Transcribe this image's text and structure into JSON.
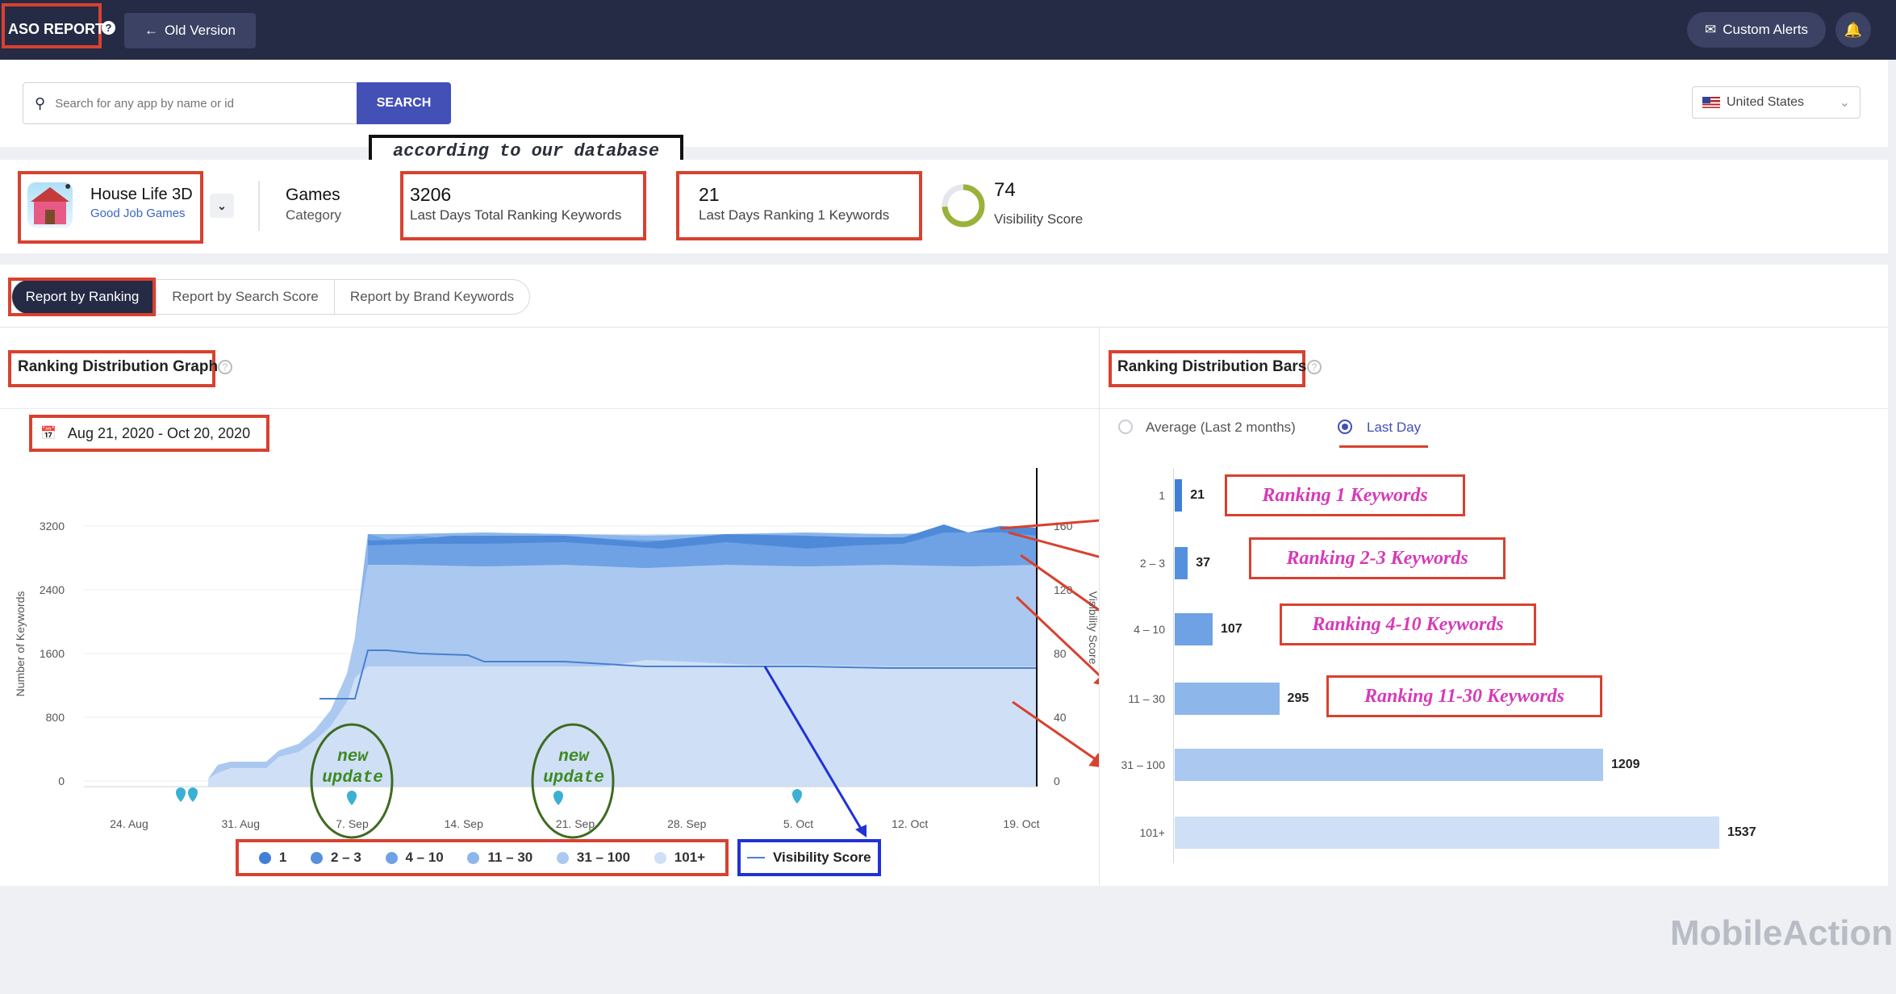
{
  "topbar": {
    "aso_report": "ASO REPORT",
    "old_version": "Old Version",
    "custom_alerts": "Custom Alerts"
  },
  "search": {
    "placeholder": "Search for any app by name or id",
    "button": "SEARCH",
    "country": "United States"
  },
  "annotation_database": "according to our database",
  "app": {
    "name": "House Life 3D",
    "developer": "Good Job Games",
    "category_value": "Games",
    "category_label": "Category",
    "total_keywords_value": "3206",
    "total_keywords_label": "Last Days Total Ranking Keywords",
    "rank1_value": "21",
    "rank1_label": "Last Days Ranking 1 Keywords",
    "visibility_value": "74",
    "visibility_label": "Visibility Score",
    "visibility_score": 74
  },
  "tabs": [
    "Report by Ranking",
    "Report by Search Score",
    "Report by Brand Keywords"
  ],
  "graph": {
    "title": "Ranking Distribution Graph",
    "date_range": "Aug 21, 2020 - Oct 20, 2020",
    "y_axis_label": "Number of Keywords",
    "y2_axis_label": "Visibility Score",
    "y_ticks": [
      "3200",
      "2400",
      "1600",
      "800",
      "0"
    ],
    "y2_ticks": [
      "160",
      "120",
      "80",
      "40",
      "0"
    ],
    "x_ticks": [
      "24. Aug",
      "31. Aug",
      "7. Sep",
      "14. Sep",
      "21. Sep",
      "28. Sep",
      "5. Oct",
      "12. Oct",
      "19. Oct"
    ],
    "annotation_1": "new update",
    "annotation_2": "new update"
  },
  "legend": {
    "items": [
      {
        "label": "1",
        "color": "#3f7fd6"
      },
      {
        "label": "2 – 3",
        "color": "#5590de"
      },
      {
        "label": "4 – 10",
        "color": "#6fa2e4"
      },
      {
        "label": "11 – 30",
        "color": "#8db6ea"
      },
      {
        "label": "31 – 100",
        "color": "#abc9f0"
      },
      {
        "label": "101+",
        "color": "#cfe0f6"
      }
    ],
    "visibility": "Visibility Score"
  },
  "bars_panel": {
    "title": "Ranking Distribution Bars",
    "option_average": "Average (Last 2 months)",
    "option_last_day": "Last Day"
  },
  "chart_data": {
    "type": "bar",
    "orientation": "horizontal",
    "categories": [
      "1",
      "2 – 3",
      "4 – 10",
      "11 – 30",
      "31 – 100",
      "101+"
    ],
    "values": [
      21,
      37,
      107,
      295,
      1209,
      1537
    ],
    "value_labels": [
      "21",
      "37",
      "107",
      "295",
      "1209",
      "1537"
    ],
    "colors": [
      "#3f7fd6",
      "#5590de",
      "#6fa2e4",
      "#8db6ea",
      "#abc9f0",
      "#cfe0f6"
    ],
    "xlim": [
      0,
      1537
    ]
  },
  "annotations": {
    "rank1": "Ranking 1 Keywords",
    "rank23": "Ranking 2-3 Keywords",
    "rank410": "Ranking 4-10 Keywords",
    "rank1130": "Ranking 11-30 Keywords"
  },
  "watermark": "MobileAction"
}
